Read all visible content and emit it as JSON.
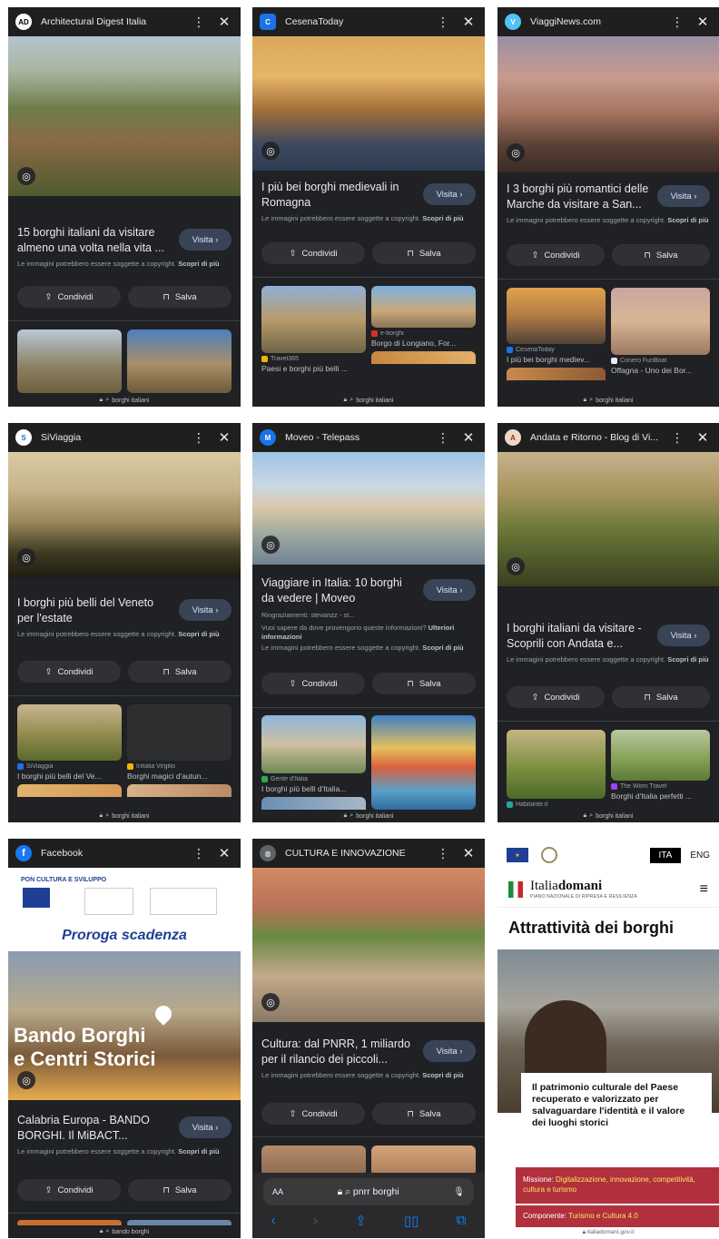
{
  "common": {
    "copyright_prefix": "Le immagini potrebbero essere soggette a copyright.",
    "copyright_link": "Scopri di più",
    "visit_label": "Visita",
    "share_label": "Condividi",
    "save_label": "Salva"
  },
  "cards": [
    {
      "site": "Architectural Digest Italia",
      "fav": "AD",
      "title": "15 borghi italiani da visitare almeno una volta nella vita ...",
      "thumbs": [
        {
          "src": "",
          "cap": ""
        },
        {
          "src": "",
          "cap": ""
        }
      ],
      "footer": "borghi italiani"
    },
    {
      "site": "CesenaToday",
      "fav": "C",
      "title": "I più bei borghi medievali in Romagna",
      "thumbs": [
        {
          "src": "Travel365",
          "cap": "Paesi e borghi più belli ..."
        },
        {
          "src": "e-borghi",
          "cap": "Borgo di Longiano, For..."
        }
      ],
      "footer": "borghi italiani"
    },
    {
      "site": "ViaggiNews.com",
      "fav": "V",
      "title": "I 3 borghi più romantici delle Marche da visitare a San...",
      "thumbs": [
        {
          "src": "CesenaToday",
          "cap": "I più bei borghi mediev..."
        },
        {
          "src": "Conero FunBoat",
          "cap": "Offagna - Uno dei Bor..."
        }
      ],
      "footer": "borghi italiani"
    },
    {
      "site": "SiViaggia",
      "fav": "S",
      "title": "I borghi più belli del Veneto per l'estate",
      "thumbs": [
        {
          "src": "SiViaggia",
          "cap": "I borghi più belli del Ve..."
        },
        {
          "src": "Initalia Virgilio",
          "cap": "Borghi magici d'autun..."
        }
      ],
      "footer": "borghi italiani"
    },
    {
      "site": "Moveo - Telepass",
      "fav": "M",
      "title": "Viaggiare in Italia: 10 borghi da vedere | Moveo",
      "credit": "Ringraziamenti: stevanzz - st...",
      "info_q": "Vuoi sapere da dove provengono queste informazioni?",
      "info_link": "Ulteriori informazioni",
      "thumbs": [
        {
          "src": "Gente d'Italia",
          "cap": "I borghi più belli d'Italia..."
        },
        {
          "src": "",
          "cap": ""
        }
      ],
      "footer": "borghi italiani"
    },
    {
      "site": "Andata e Ritorno - Blog di Vi...",
      "fav": "A",
      "title": "I borghi italiani da visitare - Scoprili con Andata e...",
      "thumbs": [
        {
          "src": "Habitante.it",
          "cap": ""
        },
        {
          "src": "The Worn Travel",
          "cap": "Borghi d'Italia perfetti ..."
        }
      ],
      "footer": "borghi italiani"
    },
    {
      "site": "Facebook",
      "fav": "f",
      "title": "Calabria Europa - BANDO BORGHI. Il MiBACT...",
      "poster": {
        "header": "PON CULTURA E SVILUPPO",
        "headline": "Proroga scadenza",
        "line1": "Bando Borghi",
        "line2": "e Centri Storici"
      },
      "footer": "bando borghi"
    },
    {
      "site": "CULTURA E INNOVAZIONE",
      "fav": "",
      "title": "Cultura: dal PNRR, 1 miliardo per il rilancio dei piccoli...",
      "safari": {
        "aa": "AA",
        "url": "pnrr borghi"
      }
    }
  ],
  "web": {
    "lang_ita": "ITA",
    "lang_eng": "ENG",
    "brand_light": "Italia",
    "brand_bold": "domani",
    "brand_sub": "PIANO NAZIONALE DI RIPRESA E RESILIENZA",
    "heading": "Attrattività dei borghi",
    "card_text": "Il patrimonio culturale del Paese recuperato e valorizzato per salvaguardare l'identità e il valore dei luoghi storici",
    "mission_label": "Missione:",
    "mission_value": "Digitalizzazione, innovazione, competitività, cultura e turismo",
    "comp_label": "Componente:",
    "comp_value": "Turismo e Cultura 4.0",
    "footer_url": "italiadomani.gov.it"
  },
  "colors": {
    "panel_bg": "#202124",
    "visit_bg": "#394457",
    "chip_bg": "#303134",
    "mission_bg": "#b0303e"
  }
}
